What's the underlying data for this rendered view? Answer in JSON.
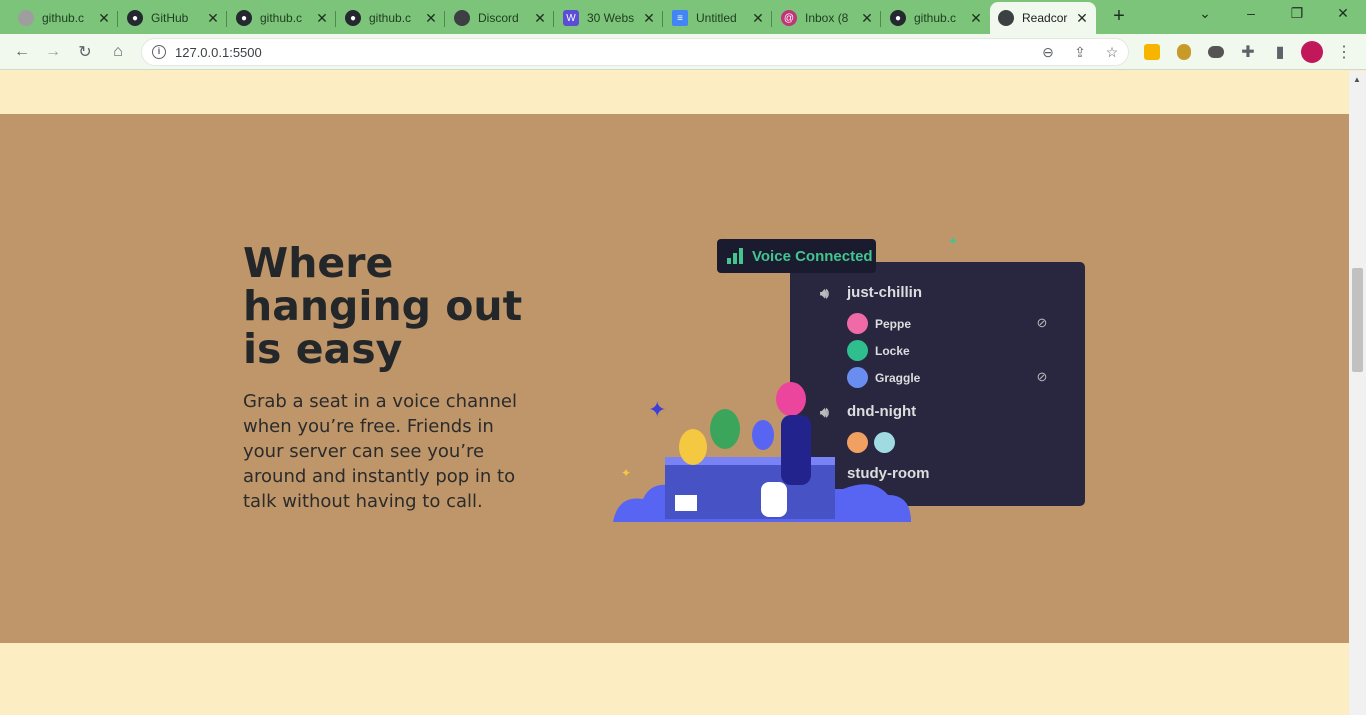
{
  "browser": {
    "tabs": [
      {
        "title": "github.c",
        "icon": "globe-icon",
        "color": "#9e9e9e"
      },
      {
        "title": "GitHub",
        "icon": "github-icon",
        "color": "#24292f"
      },
      {
        "title": "github.c",
        "icon": "github-icon",
        "color": "#24292f"
      },
      {
        "title": "github.c",
        "icon": "github-icon",
        "color": "#24292f"
      },
      {
        "title": "Discord",
        "icon": "globe-icon",
        "color": "#3c4043"
      },
      {
        "title": "30 Webs",
        "icon": "webflow-icon",
        "color": "#5b4dd6"
      },
      {
        "title": "Untitled",
        "icon": "docs-icon",
        "color": "#4285f4"
      },
      {
        "title": "Inbox (8",
        "icon": "mail-icon",
        "color": "#c0357a"
      },
      {
        "title": "github.c",
        "icon": "github-icon",
        "color": "#24292f"
      },
      {
        "title": "Readcor",
        "icon": "globe-icon",
        "color": "#3c4043"
      }
    ],
    "url": "127.0.0.1:5500"
  },
  "hero": {
    "headline": "Where hanging out is easy",
    "description": "Grab a seat in a voice channel when you’re free. Friends in your server can see you’re around and instantly pop in to talk without having to call."
  },
  "discord": {
    "badge": "Voice Connected",
    "channels": [
      {
        "name": "just-chillin",
        "members": [
          {
            "name": "Peppe",
            "color": "#f06aa8",
            "muted": true
          },
          {
            "name": "Locke",
            "color": "#2fbf8f",
            "muted": false
          },
          {
            "name": "Graggle",
            "color": "#6a8ef0",
            "muted": true
          }
        ]
      },
      {
        "name": "dnd-night"
      },
      {
        "name": "study-room"
      }
    ],
    "dnd_avatars": [
      "#f0a060",
      "#9fdbe0"
    ]
  },
  "colors": {
    "page_bg": "#fcedc2",
    "hero_bg": "#bf9669",
    "tab_strip": "#7bc47a",
    "voice_green": "#43c58f",
    "panel": "#28273f"
  }
}
